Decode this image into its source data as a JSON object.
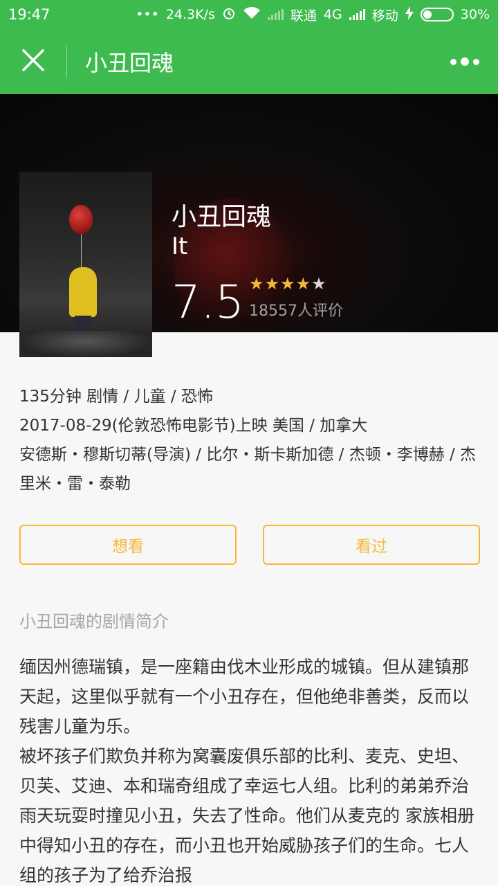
{
  "status_bar": {
    "time": "19:47",
    "dots": "•••",
    "net_speed": "24.3K/s",
    "carrier1": "联通",
    "network": "4G",
    "carrier2": "移动",
    "battery": "30%",
    "battery_level": 0.3
  },
  "nav": {
    "title": "小丑回魂",
    "close_icon": "close-icon",
    "more_icon": "more-dots-icon"
  },
  "movie": {
    "title": "小丑回魂",
    "original_title": "It",
    "rating": "7.5",
    "stars_filled": 4,
    "stars_total": 5,
    "votes": "18557人评价",
    "info_lines": [
      "135分钟 剧情 / 儿童 / 恐怖",
      "2017-08-29(伦敦恐怖电影节)上映 美国 / 加拿大",
      "安德斯・穆斯切蒂(导演) / 比尔・斯卡斯加德 / 杰顿・李博赫 / 杰里米・雷・泰勒"
    ]
  },
  "actions": {
    "want": "想看",
    "seen": "看过"
  },
  "summary": {
    "heading": "小丑回魂的剧情简介",
    "para1": "缅因州德瑞镇，是一座籍由伐木业形成的城镇。但从建镇那天起，这里似乎就有一个小丑存在，但他绝非善类，反而以残害儿童为乐。",
    "para2": "被坏孩子们欺负并称为窝囊废俱乐部的比利、麦克、史坦、贝芙、艾迪、本和瑞奇组成了幸运七人组。比利的弟弟乔治雨天玩耍时撞见小丑，失去了性命。他们从麦克的 家族相册中得知小丑的存在，而小丑也开始威胁孩子们的生命。七人组的孩子为了给乔治报"
  },
  "colors": {
    "brand_green": "#3dbb4f",
    "accent_orange": "#f5b93a"
  }
}
